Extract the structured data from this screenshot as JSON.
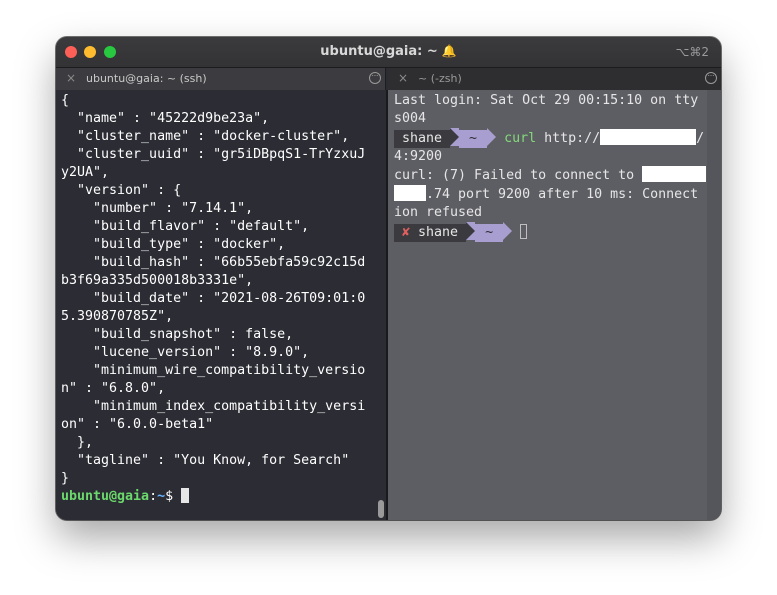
{
  "window": {
    "title": "ubuntu@gaia: ~",
    "bell_icon": "bell-icon",
    "shortcut": "⌥⌘2"
  },
  "tabs": [
    {
      "label": "ubuntu@gaia: ~ (ssh)",
      "close": "×",
      "more": "···"
    },
    {
      "label": "~ (-zsh)",
      "close": "×",
      "more": "···"
    }
  ],
  "left_pane": {
    "lines": [
      "{",
      "  \"name\" : \"45222d9be23a\",",
      "  \"cluster_name\" : \"docker-cluster\",",
      "  \"cluster_uuid\" : \"gr5iDBpqS1-TrYzxuJ",
      "y2UA\",",
      "  \"version\" : {",
      "    \"number\" : \"7.14.1\",",
      "    \"build_flavor\" : \"default\",",
      "    \"build_type\" : \"docker\",",
      "    \"build_hash\" : \"66b55ebfa59c92c15d",
      "b3f69a335d500018b3331e\",",
      "    \"build_date\" : \"2021-08-26T09:01:0",
      "5.390870785Z\",",
      "    \"build_snapshot\" : false,",
      "    \"lucene_version\" : \"8.9.0\",",
      "    \"minimum_wire_compatibility_versio",
      "n\" : \"6.8.0\",",
      "    \"minimum_index_compatibility_versi",
      "on\" : \"6.0.0-beta1\"",
      "  },",
      "  \"tagline\" : \"You Know, for Search\"",
      "}"
    ],
    "prompt_user": "ubuntu@gaia",
    "prompt_sep": ":",
    "prompt_path": "~",
    "prompt_symbol": "$ "
  },
  "right_pane": {
    "login_line1": "Last login: Sat Oct 29 00:15:10 on tty",
    "login_line2": "s004",
    "prompt_user": "shane",
    "prompt_dir": "~",
    "command": "curl",
    "command_arg": "http://",
    "command_tail": "/",
    "cmd_line2": "4:9200",
    "error_line1": "curl: (7) Failed to connect to ",
    "error_line2_end": ".74 port 9200 after 10 ms: Connect",
    "error_line3": "ion refused",
    "fail_mark": "✘",
    "prompt2_user": "shane",
    "prompt2_dir": "~"
  },
  "colors": {
    "prompt_green": "#6bd96b",
    "prompt_blue": "#6ab4ff",
    "segment_purple": "#a99ed0",
    "fail_red": "#e06060"
  }
}
